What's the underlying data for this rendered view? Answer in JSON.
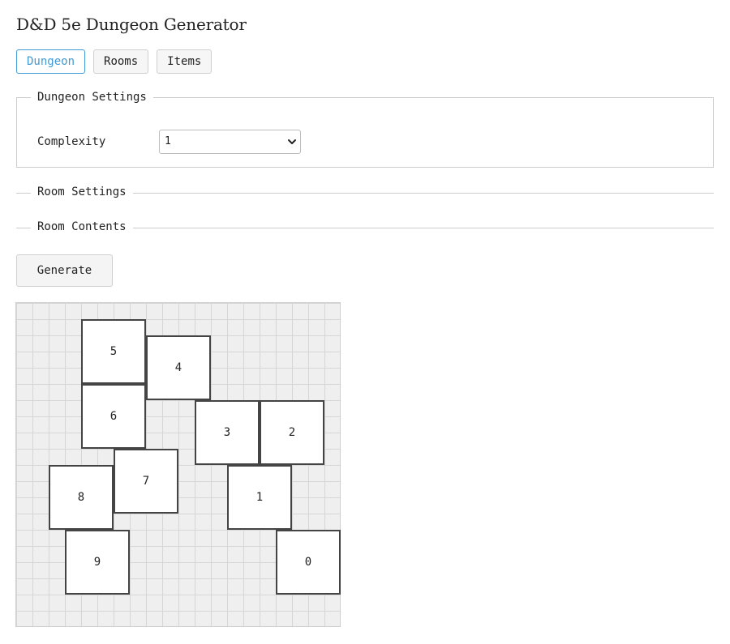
{
  "app": {
    "title": "D&D 5e Dungeon Generator"
  },
  "tabs": [
    {
      "label": "Dungeon",
      "active": true
    },
    {
      "label": "Rooms",
      "active": false
    },
    {
      "label": "Items",
      "active": false
    }
  ],
  "dungeon_settings": {
    "legend": "Dungeon Settings",
    "complexity_label": "Complexity",
    "complexity_value": "1"
  },
  "room_settings": {
    "legend": "Room Settings"
  },
  "room_contents": {
    "legend": "Room Contents"
  },
  "generate": {
    "label": "Generate"
  },
  "map": {
    "rooms": [
      {
        "label": "0"
      },
      {
        "label": "1"
      },
      {
        "label": "2"
      },
      {
        "label": "3"
      },
      {
        "label": "4"
      },
      {
        "label": "5"
      },
      {
        "label": "6"
      },
      {
        "label": "7"
      },
      {
        "label": "8"
      },
      {
        "label": "9"
      }
    ]
  },
  "colors": {
    "accent": "#3f9ad6",
    "map_background": "#efefef",
    "grid_line": "#d6d6d6",
    "room_border": "#444444",
    "room_fill": "#ffffff"
  },
  "icons": {
    "select_chevron": "chevron-down-icon"
  }
}
